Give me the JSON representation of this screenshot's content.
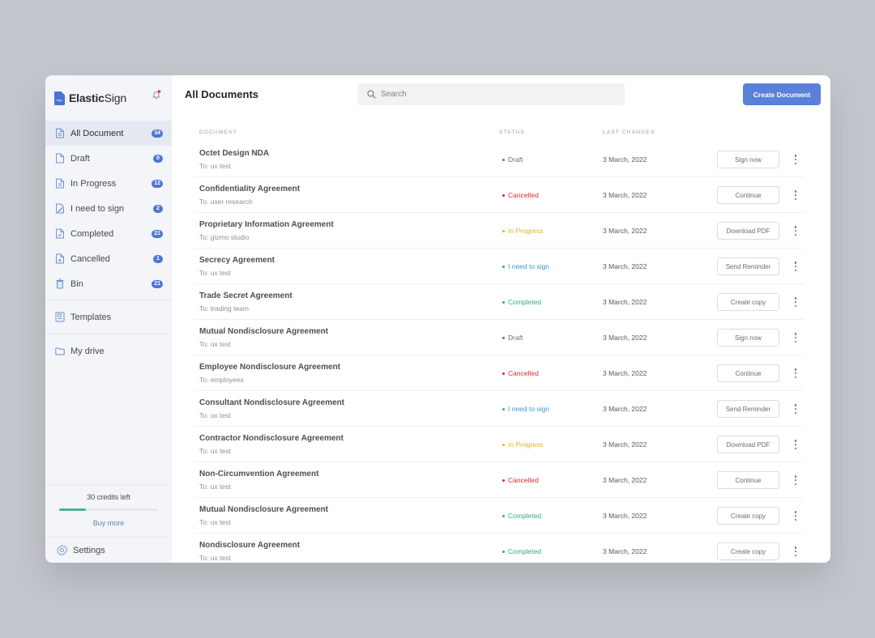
{
  "app": {
    "brand_bold": "Elastic",
    "brand_light": "Sign",
    "accent_color": "#5b80d9"
  },
  "sidebar": {
    "items": [
      {
        "label": "All Document",
        "count": "34",
        "icon": "document-icon",
        "active": true
      },
      {
        "label": "Draft",
        "count": "0",
        "icon": "draft-file-icon",
        "active": false
      },
      {
        "label": "In Progress",
        "count": "12",
        "icon": "document-icon",
        "active": false
      },
      {
        "label": "I need to sign",
        "count": "2",
        "icon": "sign-document-icon",
        "active": false
      },
      {
        "label": "Completed",
        "count": "21",
        "icon": "completed-document-icon",
        "active": false
      },
      {
        "label": "Cancelled",
        "count": "1",
        "icon": "cancelled-document-icon",
        "active": false
      },
      {
        "label": "Bin",
        "count": "21",
        "icon": "trash-icon",
        "active": false
      }
    ],
    "templates_label": "Templates",
    "drive_label": "My drive",
    "credits": {
      "text": "30 credits left",
      "progress_percent": 27,
      "buy_more_label": "Buy more"
    },
    "settings_label": "Settings"
  },
  "header": {
    "title": "All Documents",
    "search_placeholder": "Search",
    "create_button_label": "Create Document"
  },
  "table": {
    "columns": {
      "document": "DOCUMENT",
      "status": "STATUS",
      "last_changes": "LAST CHANGES"
    },
    "status_colors": {
      "Draft": "#6d7077",
      "Cancelled": "#d92d2d",
      "In Progress": "#e5b424",
      "I need to sign": "#3b9ad4",
      "Completed": "#2bb07a"
    },
    "rows": [
      {
        "name": "Octet Design NDA",
        "to": "To: ux test",
        "status": "Draft",
        "date": "3 March, 2022",
        "action": "Sign now"
      },
      {
        "name": "Confidentiality Agreement",
        "to": "To: user research",
        "status": "Cancelled",
        "date": "3 March, 2022",
        "action": "Continue"
      },
      {
        "name": "Proprietary Information Agreement",
        "to": "To: gizmo studio",
        "status": "In Progress",
        "date": "3 March, 2022",
        "action": "Download PDF"
      },
      {
        "name": "Secrecy Agreement",
        "to": "To: ux test",
        "status": "I need to  sign",
        "statusKey": "I need to sign",
        "date": "3 March, 2022",
        "action": "Send Reminder"
      },
      {
        "name": "Trade Secret Agreement",
        "to": "To: trading team",
        "status": "Completed",
        "date": "3 March, 2022",
        "action": "Create copy"
      },
      {
        "name": "Mutual Nondisclosure Agreement",
        "to": "To: ux test",
        "status": "Draft",
        "date": "3 March, 2022",
        "action": "Sign now"
      },
      {
        "name": "Employee Nondisclosure Agreement",
        "to": "To: employees",
        "status": "Cancelled",
        "date": "3 March, 2022",
        "action": "Continue"
      },
      {
        "name": "Consultant Nondisclosure Agreement",
        "to": "To: ux test",
        "status": "I need to sign",
        "date": "3 March, 2022",
        "action": "Send Reminder"
      },
      {
        "name": "Contractor Nondisclosure Agreement",
        "to": "To: ux test",
        "status": "In Progress",
        "date": "3 March, 2022",
        "action": "Download PDF"
      },
      {
        "name": "Non-Circumvention Agreement",
        "to": "To: ux test",
        "status": "Cancelled",
        "date": "3 March, 2022",
        "action": "Continue"
      },
      {
        "name": "Mutual Nondisclosure Agreement",
        "to": "To: ux test",
        "status": "Completed",
        "date": "3 March, 2022",
        "action": "Create copy"
      },
      {
        "name": "Nondisclosure Agreement",
        "to": "To: ux test",
        "status": "Completed",
        "date": "3 March, 2022",
        "action": "Create copy"
      }
    ]
  }
}
